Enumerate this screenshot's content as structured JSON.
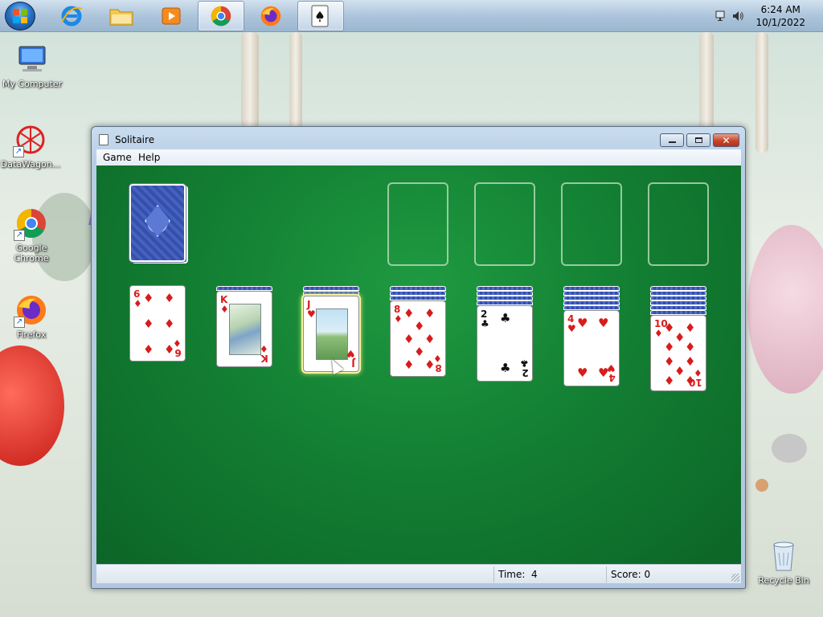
{
  "taskbar": {
    "items": [
      {
        "name": "start-orb",
        "icon": "windows-logo-icon"
      },
      {
        "name": "internet-explorer",
        "icon": "internet-explorer-icon"
      },
      {
        "name": "file-explorer",
        "icon": "folder-icon"
      },
      {
        "name": "media-player",
        "icon": "media-player-icon"
      },
      {
        "name": "chrome",
        "icon": "chrome-icon",
        "active": true
      },
      {
        "name": "firefox",
        "icon": "firefox-icon"
      },
      {
        "name": "solitaire",
        "icon": "solitaire-icon",
        "active": true
      }
    ],
    "tray_icons": [
      "network-icon",
      "volume-icon"
    ],
    "clock_time": "6:24 AM",
    "clock_date": "10/1/2022"
  },
  "desktop_icons": [
    {
      "label": "My Computer",
      "icon": "computer-icon"
    },
    {
      "label": "DataWagon...",
      "icon": "datawagon-icon"
    },
    {
      "label": "Google Chrome",
      "icon": "chrome-icon"
    },
    {
      "label": "Firefox",
      "icon": "firefox-icon"
    },
    {
      "label": "Recycle Bin",
      "icon": "recycle-bin-icon"
    }
  ],
  "window": {
    "title": "Solitaire",
    "menu": [
      "Game",
      "Help"
    ],
    "status": {
      "time_label": "Time:",
      "time_value": "4",
      "score_label": "Score: 0"
    }
  },
  "game": {
    "stock": {
      "face_down": true
    },
    "foundations": [
      null,
      null,
      null,
      null
    ],
    "tableau": [
      {
        "hidden": 0,
        "top": {
          "rank": "6",
          "suit": "♦",
          "color": "red"
        }
      },
      {
        "hidden": 1,
        "top": {
          "rank": "K",
          "suit": "♦",
          "color": "red"
        }
      },
      {
        "hidden": 2,
        "top": {
          "rank": "J",
          "suit": "♥",
          "color": "red"
        },
        "selected": true
      },
      {
        "hidden": 3,
        "top": {
          "rank": "8",
          "suit": "♦",
          "color": "red"
        }
      },
      {
        "hidden": 4,
        "top": {
          "rank": "2",
          "suit": "♣",
          "color": "black"
        }
      },
      {
        "hidden": 5,
        "top": {
          "rank": "4",
          "suit": "♥",
          "color": "red"
        }
      },
      {
        "hidden": 6,
        "top": {
          "rank": "10",
          "suit": "♦",
          "color": "red"
        }
      }
    ]
  },
  "colors": {
    "felt": "#138033",
    "card_back": "#3d5ab8",
    "red_suit": "#d81c1c"
  }
}
